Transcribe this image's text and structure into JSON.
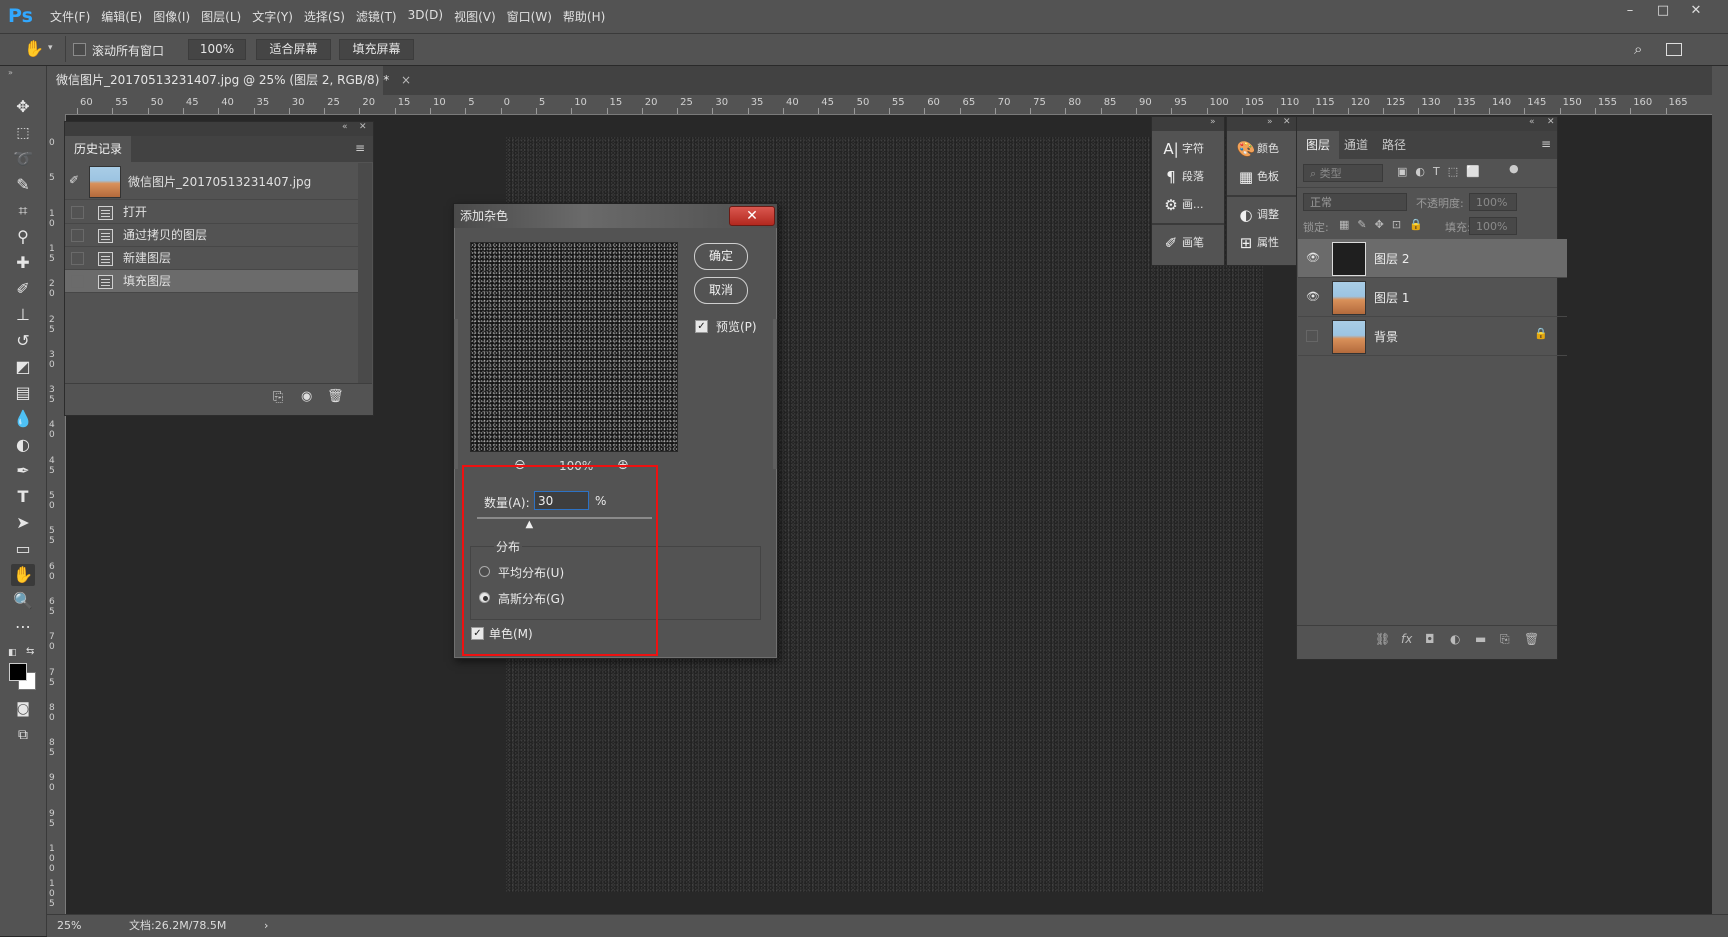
{
  "app": {
    "logo": "Ps",
    "menu": [
      "文件(F)",
      "编辑(E)",
      "图像(I)",
      "图层(L)",
      "文字(Y)",
      "选择(S)",
      "滤镜(T)",
      "3D(D)",
      "视图(V)",
      "窗口(W)",
      "帮助(H)"
    ],
    "window_controls": [
      "–",
      "□",
      "✕"
    ]
  },
  "options_bar": {
    "scroll_all_windows": "滚动所有窗口",
    "zoom_value": "100%",
    "fit_screen": "适合屏幕",
    "fill_screen": "填充屏幕"
  },
  "document": {
    "tab_title": "微信图片_20170513231407.jpg @ 25% (图层 2, RGB/8) *",
    "tab_close": "×"
  },
  "rulers": {
    "h_labels": [
      "60",
      "55",
      "50",
      "45",
      "40",
      "35",
      "30",
      "25",
      "20",
      "15",
      "10",
      "5",
      "0",
      "5",
      "10",
      "15",
      "20",
      "25",
      "30",
      "35",
      "40",
      "45",
      "50",
      "55",
      "60",
      "65",
      "70",
      "75",
      "80",
      "85",
      "90",
      "95",
      "100",
      "105",
      "110",
      "115",
      "120",
      "125",
      "130",
      "135",
      "140",
      "145",
      "150",
      "155",
      "160",
      "165"
    ],
    "v_labels": [
      "0",
      "5",
      "1 0",
      "1 5",
      "2 0",
      "2 5",
      "3 0",
      "3 5",
      "4 0",
      "4 5",
      "5 0",
      "5 5",
      "6 0",
      "6 5",
      "7 0",
      "7 5",
      "8 0",
      "8 5",
      "9 0",
      "9 5",
      "1 0 0",
      "1 0 5"
    ]
  },
  "status_bar": {
    "zoom": "25%",
    "doc_info": "文档:26.2M/78.5M",
    "arrow": "›"
  },
  "history_panel": {
    "tab": "历史记录",
    "snapshot": "微信图片_20170513231407.jpg",
    "items": [
      "打开",
      "通过拷贝的图层",
      "新建图层",
      "填充图层"
    ],
    "selected_index": 3
  },
  "dialog": {
    "title": "添加杂色",
    "ok": "确定",
    "cancel": "取消",
    "preview_label": "预览(P)",
    "preview_checked": true,
    "zoom": "100%",
    "amount_label": "数量(A):",
    "amount_value": "30",
    "amount_unit": "%",
    "amount_fraction": 0.3,
    "distribution_label": "分布",
    "uniform": "平均分布(U)",
    "gaussian": "高斯分布(G)",
    "selected_distribution": "gaussian",
    "monochrome": "单色(M)",
    "monochrome_checked": true
  },
  "mini_panel_1": {
    "items": [
      "字符",
      "段落",
      "画...",
      "画笔"
    ]
  },
  "mini_panel_2": {
    "items": [
      "颜色",
      "色板",
      "调整",
      "属性"
    ]
  },
  "layers_panel": {
    "tabs": [
      "图层",
      "通道",
      "路径"
    ],
    "filter_kind": "类型",
    "blend_mode": "正常",
    "opacity_label": "不透明度:",
    "opacity_value": "100%",
    "lock_label": "锁定:",
    "fill_label": "填充:",
    "fill_value": "100%",
    "layers": [
      {
        "name": "图层 2",
        "visible": true,
        "selected": true,
        "thumb": "dark"
      },
      {
        "name": "图层 1",
        "visible": true,
        "selected": false,
        "thumb": "photo"
      },
      {
        "name": "背景",
        "visible": false,
        "selected": false,
        "thumb": "photo",
        "locked": true
      }
    ]
  },
  "colors": {
    "panel": "#535353",
    "canvas": "#282828",
    "highlight": "#e11111",
    "close_red": "#c8372f"
  }
}
